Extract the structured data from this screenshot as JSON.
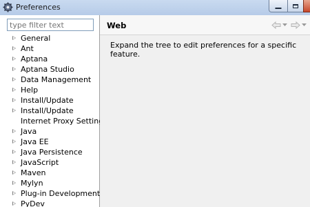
{
  "window": {
    "title": "Preferences"
  },
  "filter": {
    "placeholder": "type filter text"
  },
  "tree": {
    "items": [
      {
        "label": "General",
        "expandable": true
      },
      {
        "label": "Ant",
        "expandable": true
      },
      {
        "label": "Aptana",
        "expandable": true
      },
      {
        "label": "Aptana Studio",
        "expandable": true
      },
      {
        "label": "Data Management",
        "expandable": true
      },
      {
        "label": "Help",
        "expandable": true
      },
      {
        "label": "Install/Update",
        "expandable": true
      },
      {
        "label": "Install/Update",
        "expandable": true
      },
      {
        "label": "Internet Proxy Settings",
        "expandable": false
      },
      {
        "label": "Java",
        "expandable": true
      },
      {
        "label": "Java EE",
        "expandable": true
      },
      {
        "label": "Java Persistence",
        "expandable": true
      },
      {
        "label": "JavaScript",
        "expandable": true
      },
      {
        "label": "Maven",
        "expandable": true
      },
      {
        "label": "Mylyn",
        "expandable": true
      },
      {
        "label": "Plug-in Development",
        "expandable": true
      },
      {
        "label": "PyDev",
        "expandable": true
      }
    ]
  },
  "page": {
    "title": "Web",
    "description": "Expand the tree to edit preferences for a specific feature."
  },
  "icons": {
    "app": "eclipse-gear-icon",
    "back": "back-arrow-icon",
    "forward": "forward-arrow-icon",
    "dropdown": "chevron-down-icon",
    "tree_toggle": "triangle-right-icon"
  }
}
